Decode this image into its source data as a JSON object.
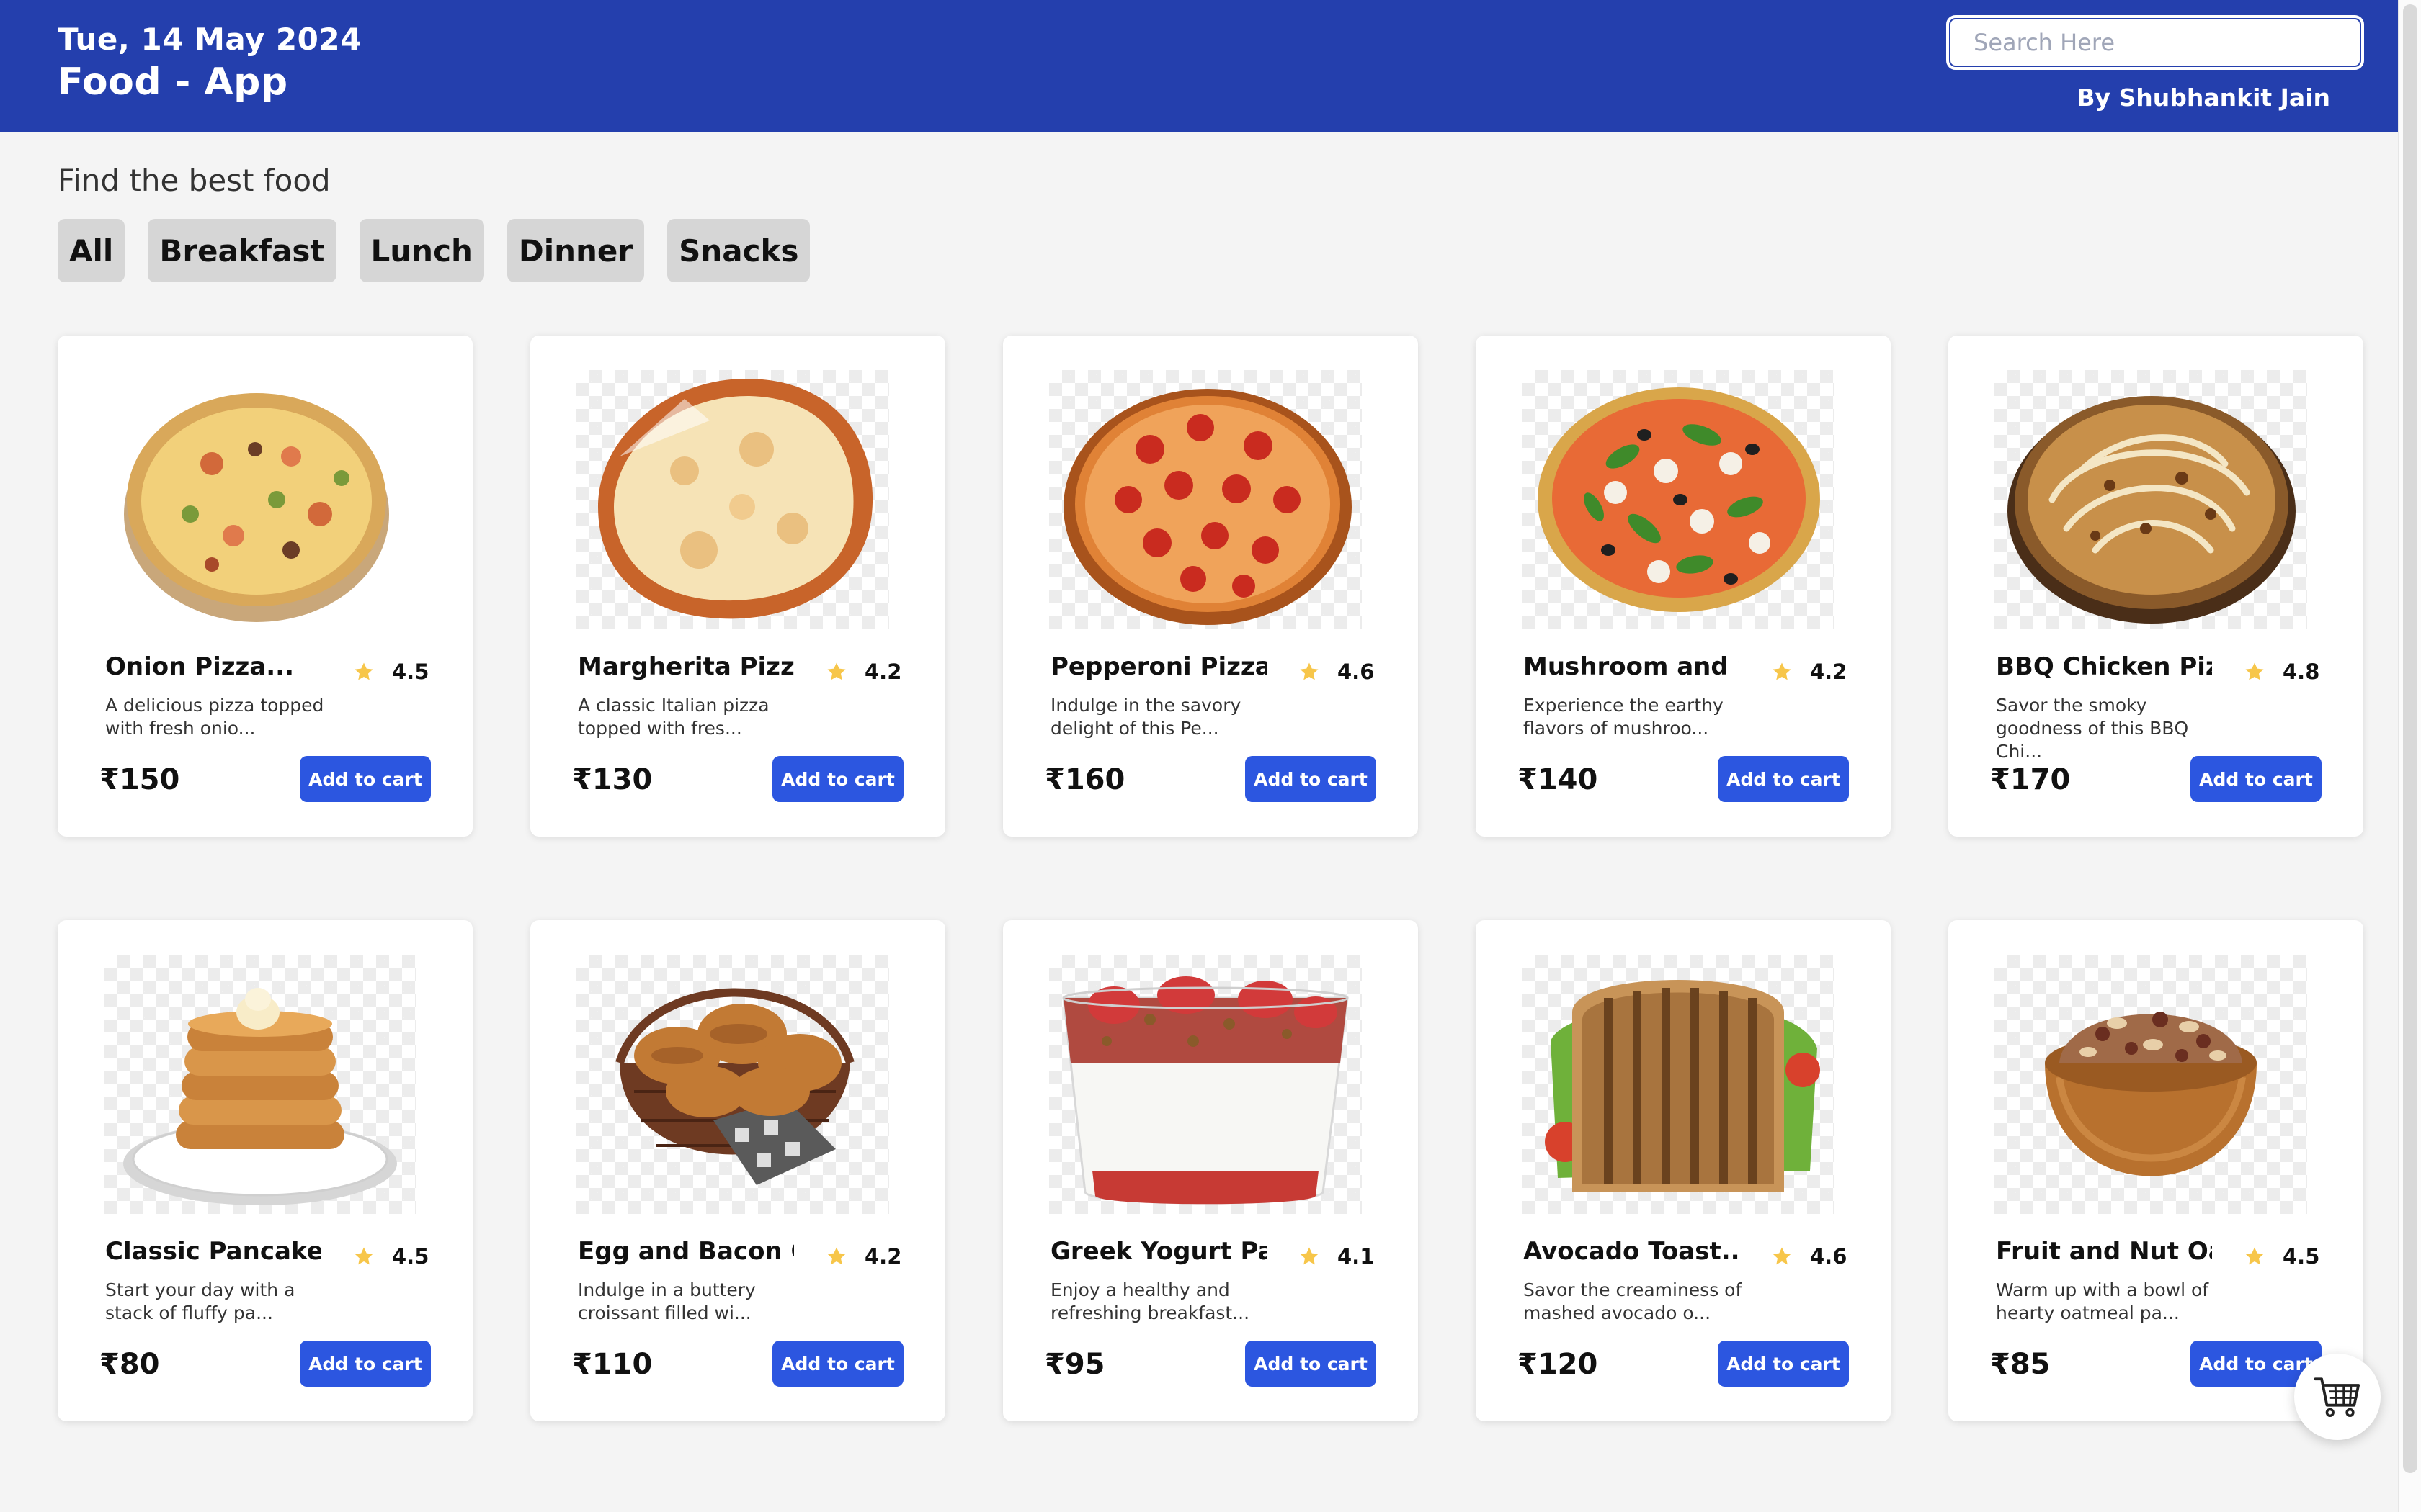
{
  "header": {
    "date": "Tue, 14 May 2024",
    "title": "Food - App",
    "search_placeholder": "Search Here",
    "search_value": "",
    "author": "By Shubhankit Jain"
  },
  "filters": {
    "heading": "Find the best food",
    "chips": [
      "All",
      "Breakfast",
      "Lunch",
      "Dinner",
      "Snacks"
    ]
  },
  "items": [
    {
      "name": "Onion Pizza...",
      "rating": "4.5",
      "desc": "A delicious pizza topped with fresh onio...",
      "price": "₹150",
      "button": "Add to cart",
      "image": "onion-pizza"
    },
    {
      "name": "Margherita Pizza...",
      "rating": "4.2",
      "desc": "A classic Italian pizza topped with fres...",
      "price": "₹130",
      "button": "Add to cart",
      "image": "margherita-pizza"
    },
    {
      "name": "Pepperoni Pizza...",
      "rating": "4.6",
      "desc": "Indulge in the savory delight of this Pe...",
      "price": "₹160",
      "button": "Add to cart",
      "image": "pepperoni-pizza"
    },
    {
      "name": "Mushroom and Spi...",
      "rating": "4.2",
      "desc": "Experience the earthy flavors of mushroo...",
      "price": "₹140",
      "button": "Add to cart",
      "image": "mushroom-pizza"
    },
    {
      "name": "BBQ Chicken Pizz...",
      "rating": "4.8",
      "desc": "Savor the smoky goodness of this BBQ Chi...",
      "price": "₹170",
      "button": "Add to cart",
      "image": "bbq-chicken-pizza"
    },
    {
      "name": "Classic Pancakes...",
      "rating": "4.5",
      "desc": "Start your day with a stack of fluffy pa...",
      "price": "₹80",
      "button": "Add to cart",
      "image": "pancakes"
    },
    {
      "name": "Egg and Bacon Cr...",
      "rating": "4.2",
      "desc": "Indulge in a buttery croissant filled wi...",
      "price": "₹110",
      "button": "Add to cart",
      "image": "croissant-basket"
    },
    {
      "name": "Greek Yogurt Par...",
      "rating": "4.1",
      "desc": "Enjoy a healthy and refreshing breakfast...",
      "price": "₹95",
      "button": "Add to cart",
      "image": "yogurt-parfait"
    },
    {
      "name": "Avocado Toast...",
      "rating": "4.6",
      "desc": "Savor the creaminess of mashed avocado o...",
      "price": "₹120",
      "button": "Add to cart",
      "image": "avocado-toast"
    },
    {
      "name": "Fruit and Nut Oa...",
      "rating": "4.5",
      "desc": "Warm up with a bowl of hearty oatmeal pa...",
      "price": "₹85",
      "button": "Add to cart",
      "image": "oatmeal-bowl"
    }
  ],
  "icons": {
    "star": "star-icon",
    "cart": "shopping-cart-icon"
  },
  "colors": {
    "header_bg": "#243fad",
    "button_bg": "#2c56e0",
    "star": "#f7c64a",
    "chip_bg": "#d6d6d6",
    "page_bg": "#f4f4f4"
  }
}
